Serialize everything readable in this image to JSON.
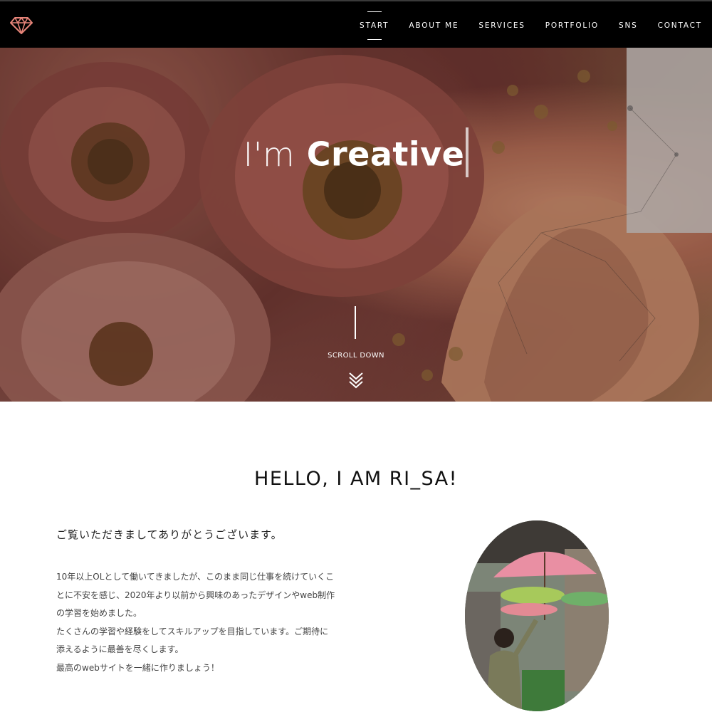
{
  "nav": {
    "logo_icon": "diamond-icon",
    "accent_color": "#e8857a",
    "items": [
      {
        "label": "START",
        "active": true
      },
      {
        "label": "ABOUT ME",
        "active": false
      },
      {
        "label": "SERVICES",
        "active": false
      },
      {
        "label": "PORTFOLIO",
        "active": false
      },
      {
        "label": "SNS",
        "active": false
      },
      {
        "label": "CONTACT",
        "active": false
      }
    ]
  },
  "hero": {
    "headline_light": "I'm",
    "headline_strong": "Creative",
    "scroll_label": "SCROLL DOWN",
    "scroll_icon": "double-chevron-down-icon"
  },
  "about": {
    "title": "HELLO, I AM RI_SA!",
    "greeting": "ご覧いただきましてありがとうございます。",
    "paragraphs": [
      "10年以上OLとして働いてきましたが、このまま同じ仕事を続けていくこ",
      "とに不安を感じ、2020年より以前から興味のあったデザインやweb制作",
      "の学習を始めました。",
      "たくさんの学習や経験をしてスキルアップを目指しています。ご期待に",
      "添えるように最善を尽くします。",
      "最高のwebサイトを一緒に作りましょう！"
    ]
  }
}
